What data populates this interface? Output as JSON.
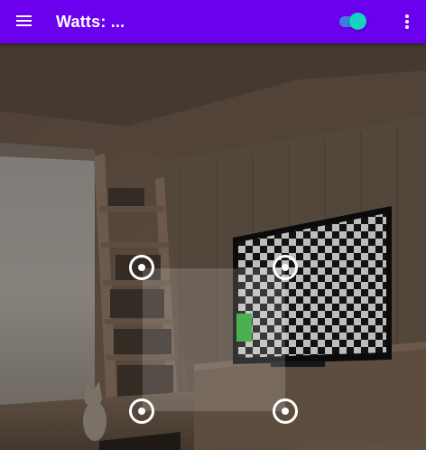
{
  "app_bar": {
    "title": "Watts: ...",
    "menu_icon": "hamburger-menu-icon",
    "toggle": {
      "state": "on",
      "track_color": "#3d7ee0",
      "thumb_color": "#14d3c0"
    },
    "overflow_icon": "more-vertical-icon",
    "background_color": "#6a00ee"
  },
  "camera_view": {
    "description_icon": "camera-preview",
    "roi_handles": [
      "top-left",
      "top-right",
      "bottom-left",
      "bottom-right"
    ],
    "marker_color": "#4caf50"
  }
}
